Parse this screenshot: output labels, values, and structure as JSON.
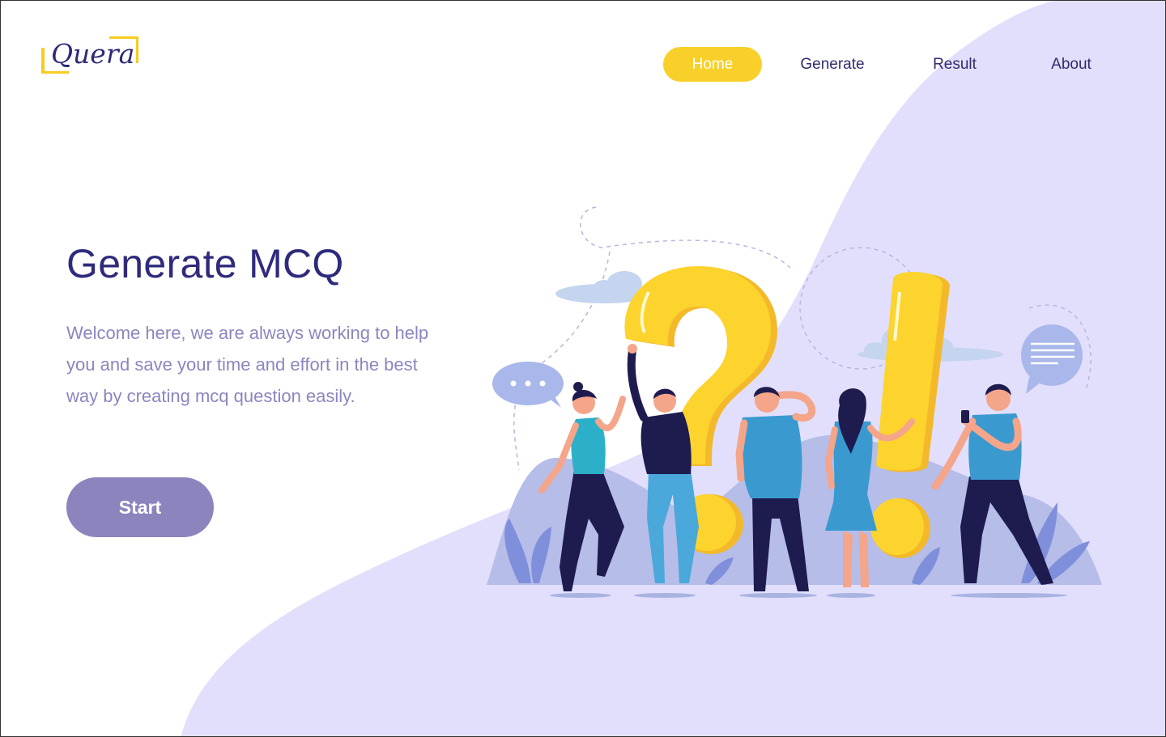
{
  "brand": {
    "logo_text": "Quera"
  },
  "nav": {
    "items": [
      {
        "label": "Home",
        "active": true
      },
      {
        "label": "Generate",
        "active": false
      },
      {
        "label": "Result",
        "active": false
      },
      {
        "label": "About",
        "active": false
      }
    ]
  },
  "hero": {
    "title": "Generate MCQ",
    "line1": "Welcome here, we are always working to help",
    "line2": "you and save your time and effort in the best",
    "line3": "way by creating mcq question  easily.",
    "cta_label": "Start"
  },
  "colors": {
    "accent_yellow": "#f9d02a",
    "brand_navy": "#2e2b7c",
    "lavender_bg": "#e2dffd",
    "button_purple": "#8b84bd",
    "text_muted": "#8a86c0"
  },
  "illustration": {
    "icons": [
      "question-mark-icon",
      "exclamation-mark-icon",
      "speech-bubble-dots-icon",
      "speech-bubble-lines-icon",
      "cloud-icon",
      "plant-icon"
    ]
  }
}
